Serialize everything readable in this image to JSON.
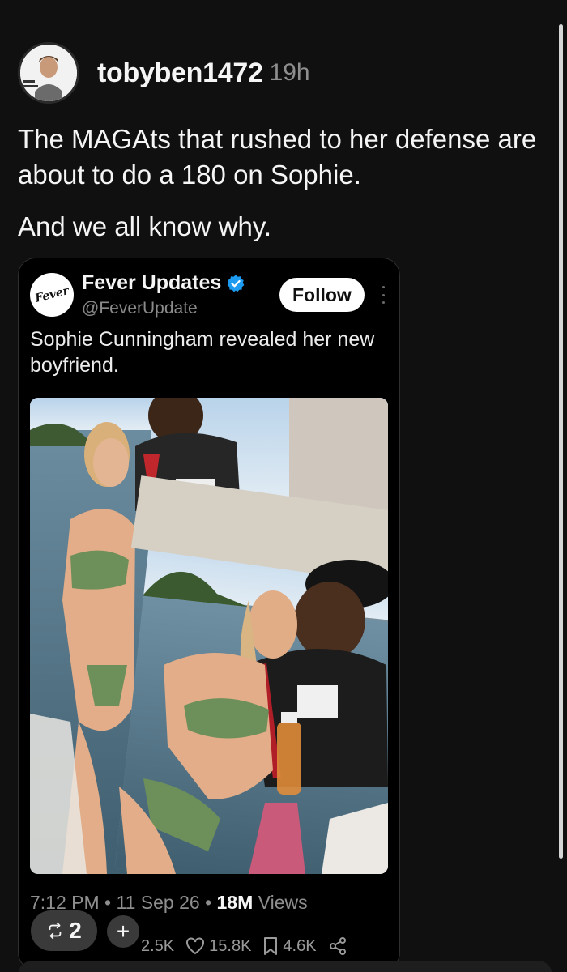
{
  "post": {
    "username": "tobyben1472",
    "timestamp": "19h",
    "text_line1": "The MAGAts that rushed to her defense are about to do a 180 on Sophie.",
    "text_line2": "And we all know why."
  },
  "embed": {
    "account_name": "Fever Updates",
    "account_handle": "@FeverUpdate",
    "logo_text": "Fever",
    "follow_label": "Follow",
    "text": "Sophie Cunningham revealed her new boyfriend.",
    "time": "7:12 PM",
    "date": "11 Sep 26",
    "views_count": "18M",
    "views_label": "Views",
    "stats": {
      "retweets": "2.5K",
      "likes": "15.8K",
      "bookmarks": "4.6K"
    }
  },
  "actions": {
    "repost_count": "2",
    "add_label": "+"
  },
  "colors": {
    "background": "#101010",
    "verified_blue": "#1d9bf0"
  }
}
